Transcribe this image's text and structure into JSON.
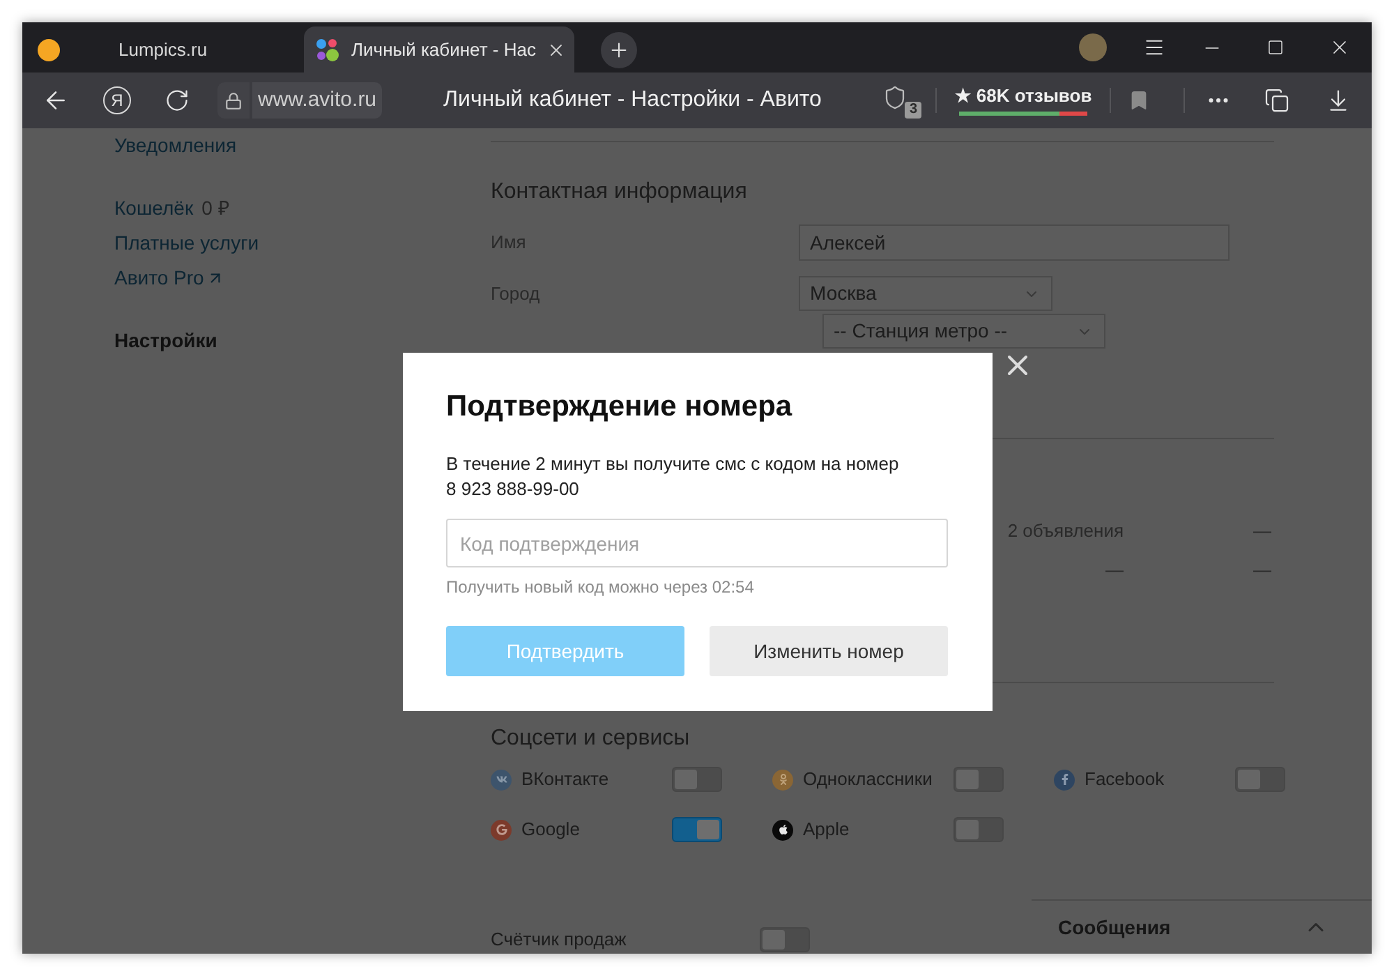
{
  "browser": {
    "tabs": [
      {
        "title": "Lumpics.ru",
        "selected": false
      },
      {
        "title": "Личный кабинет - Нас",
        "selected": true
      }
    ],
    "home_button": "Я",
    "url": "www.avito.ru",
    "page_title": "Личный кабинет - Настройки - Авито",
    "protect_badge": "3",
    "reviews": {
      "label": "★ 68K отзывов",
      "level": 0.78
    }
  },
  "sidebar": {
    "groups": [
      {
        "items": [
          {
            "label": "Уведомления",
            "selected": false,
            "external": false
          }
        ]
      },
      {
        "items": [
          {
            "label": "Кошелёк",
            "value": "0 ₽",
            "selected": false,
            "external": false
          },
          {
            "label": "Платные услуги",
            "selected": false,
            "external": false
          },
          {
            "label": "Авито Pro",
            "selected": false,
            "external": true
          }
        ]
      },
      {
        "items": [
          {
            "label": "Настройки",
            "selected": true,
            "external": false
          }
        ]
      }
    ]
  },
  "contact": {
    "title": "Контактная информация",
    "fields": [
      {
        "label": "Имя",
        "kind": "text",
        "value": "Алексей"
      },
      {
        "label": "Город",
        "kind": "select",
        "value": "Москва"
      }
    ],
    "metro": {
      "value": "-- Станция метро --"
    }
  },
  "listing_rows": [
    {
      "column_1": "2 объявления",
      "column_2": "—"
    },
    {
      "column_1": "—",
      "column_2": "—"
    }
  ],
  "socials": {
    "title": "Соцсети и сервисы",
    "items": [
      {
        "label": "ВКонтакте",
        "on": false
      },
      {
        "label": "Одноклассники",
        "on": false
      },
      {
        "label": "Facebook",
        "on": false
      },
      {
        "label": "Google",
        "on": true
      },
      {
        "label": "Apple",
        "on": false
      }
    ]
  },
  "sales_counter": {
    "label": "Счётчик продаж",
    "on": false
  },
  "chat": {
    "title": "Сообщения"
  },
  "modal": {
    "title": "Подтверждение номера",
    "message": "В течение 2 минут вы получите смс с кодом на номер",
    "phone": "8 923 888-99-00",
    "code_field": {
      "placeholder": "Код подтверждения"
    },
    "hint": "Получить новый код можно через 02:54",
    "buttons": [
      {
        "label": "Подтвердить",
        "kind": "primary",
        "disabled": true
      },
      {
        "label": "Изменить номер",
        "kind": "secondary",
        "disabled": false
      }
    ]
  }
}
